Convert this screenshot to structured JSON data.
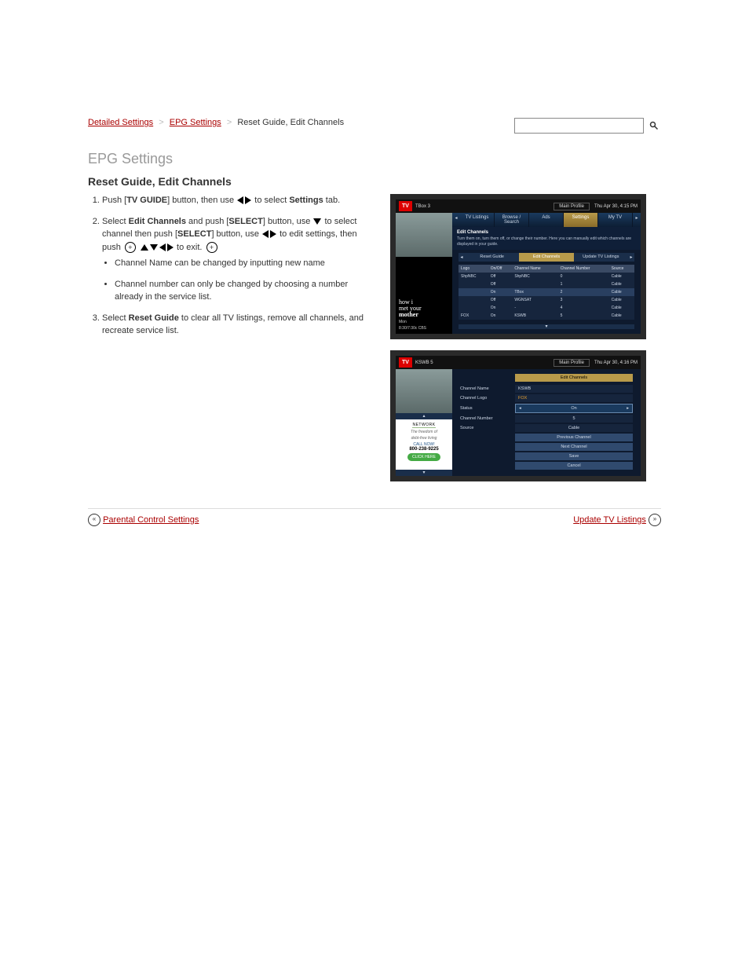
{
  "breadcrumb": {
    "items": [
      "Detailed Settings",
      "EPG Settings"
    ],
    "current": "Reset Guide, Edit Channels"
  },
  "search": {
    "placeholder": ""
  },
  "section_title": "EPG Settings",
  "subsection_title": "Reset Guide, Edit Channels",
  "steps": {
    "s1_a": "Push [",
    "s1_b": "TV GUIDE",
    "s1_c": "] button, then use",
    "s1_d": "to select",
    "s1_e": "Settings",
    "s1_f": "tab.",
    "s2_a": "Select",
    "s2_b": "Edit Channels",
    "s2_c": "and push [",
    "s2_d": "SELECT",
    "s2_e": "] button, use",
    "s2_f": "to select channel then push [",
    "s2_g": "SELECT",
    "s2_h": "] button, use",
    "s2_i": "to edit settings, then push",
    "s2_j": "to exit.",
    "s3_a": "Select",
    "s3_b": "Reset Guide",
    "s3_c": "to clear all TV listings, remove all channels, and recreate service list.",
    "s3_note1": "Channel Name can be changed by inputting new name",
    "s3_note2": "Channel number can only be changed by choosing a number already in the service list."
  },
  "footer": {
    "prev": "Parental Control Settings",
    "next": "Update TV Listings"
  },
  "screen1": {
    "logo": "TV",
    "logosub": "TBox 3",
    "profile": "Main Profile",
    "datetime": "Thu Apr 30, 4:15 PM",
    "tabs": [
      "TV Listings",
      "Browse / Search",
      "Ads",
      "Settings",
      "My TV"
    ],
    "active_tab": 3,
    "panel_title": "Edit Channels",
    "panel_desc": "Turn them on, turn them off, or change their number. Here you can manually edit which channels are displayed in your guide.",
    "subtabs": [
      "Reset Guide",
      "Edit Channels",
      "Update TV Listings"
    ],
    "active_subtab": 1,
    "columns": [
      "Logo",
      "On/Off",
      "Channel Name",
      "Channel Number",
      "Source"
    ],
    "rows": [
      {
        "logo": "ShpNBC",
        "onoff": "Off",
        "name": "ShpNBC",
        "num": "0",
        "src": "Cable",
        "sel": false
      },
      {
        "logo": "",
        "onoff": "Off",
        "name": "",
        "num": "1",
        "src": "Cable",
        "sel": false
      },
      {
        "logo": "",
        "onoff": "On",
        "name": "TBox",
        "num": "2",
        "src": "Cable",
        "sel": true
      },
      {
        "logo": "",
        "onoff": "Off",
        "name": "WGNSAT",
        "num": "3",
        "src": "Cable",
        "sel": false
      },
      {
        "logo": "",
        "onoff": "On",
        "name": "-",
        "num": "4",
        "src": "Cable",
        "sel": false
      },
      {
        "logo": "FOX",
        "onoff": "On",
        "name": "KSWB",
        "num": "5",
        "src": "Cable",
        "sel": false
      }
    ],
    "ad": {
      "line1": "how i",
      "line2": "met your",
      "line3": "mother",
      "sub": "Mon",
      "sub2": "8:30/7:30c CBS"
    }
  },
  "screen2": {
    "logo": "TV",
    "logosub": "KSWB 5",
    "profile": "Main Profile",
    "datetime": "Thu Apr 30, 4:16 PM",
    "top_btn": "Edit Channels",
    "fields": [
      {
        "label": "Channel Name",
        "value": "KSWB",
        "type": "default"
      },
      {
        "label": "Channel Logo",
        "value": "FOX",
        "type": "yellow"
      },
      {
        "label": "Status",
        "value": "On",
        "type": "selector"
      },
      {
        "label": "Channel Number",
        "value": "5",
        "type": "default"
      },
      {
        "label": "Source",
        "value": "Cable",
        "type": "default"
      }
    ],
    "buttons": [
      "Previous Channel",
      "Next Channel",
      "Save",
      "Cancel"
    ],
    "ad": {
      "network": "NETWORK",
      "slogan1": "The freedom of",
      "slogan2": "debt-free living",
      "call": "CALL NOW!",
      "phone": "800-238-9225",
      "btn": "CLICK HERE"
    }
  }
}
